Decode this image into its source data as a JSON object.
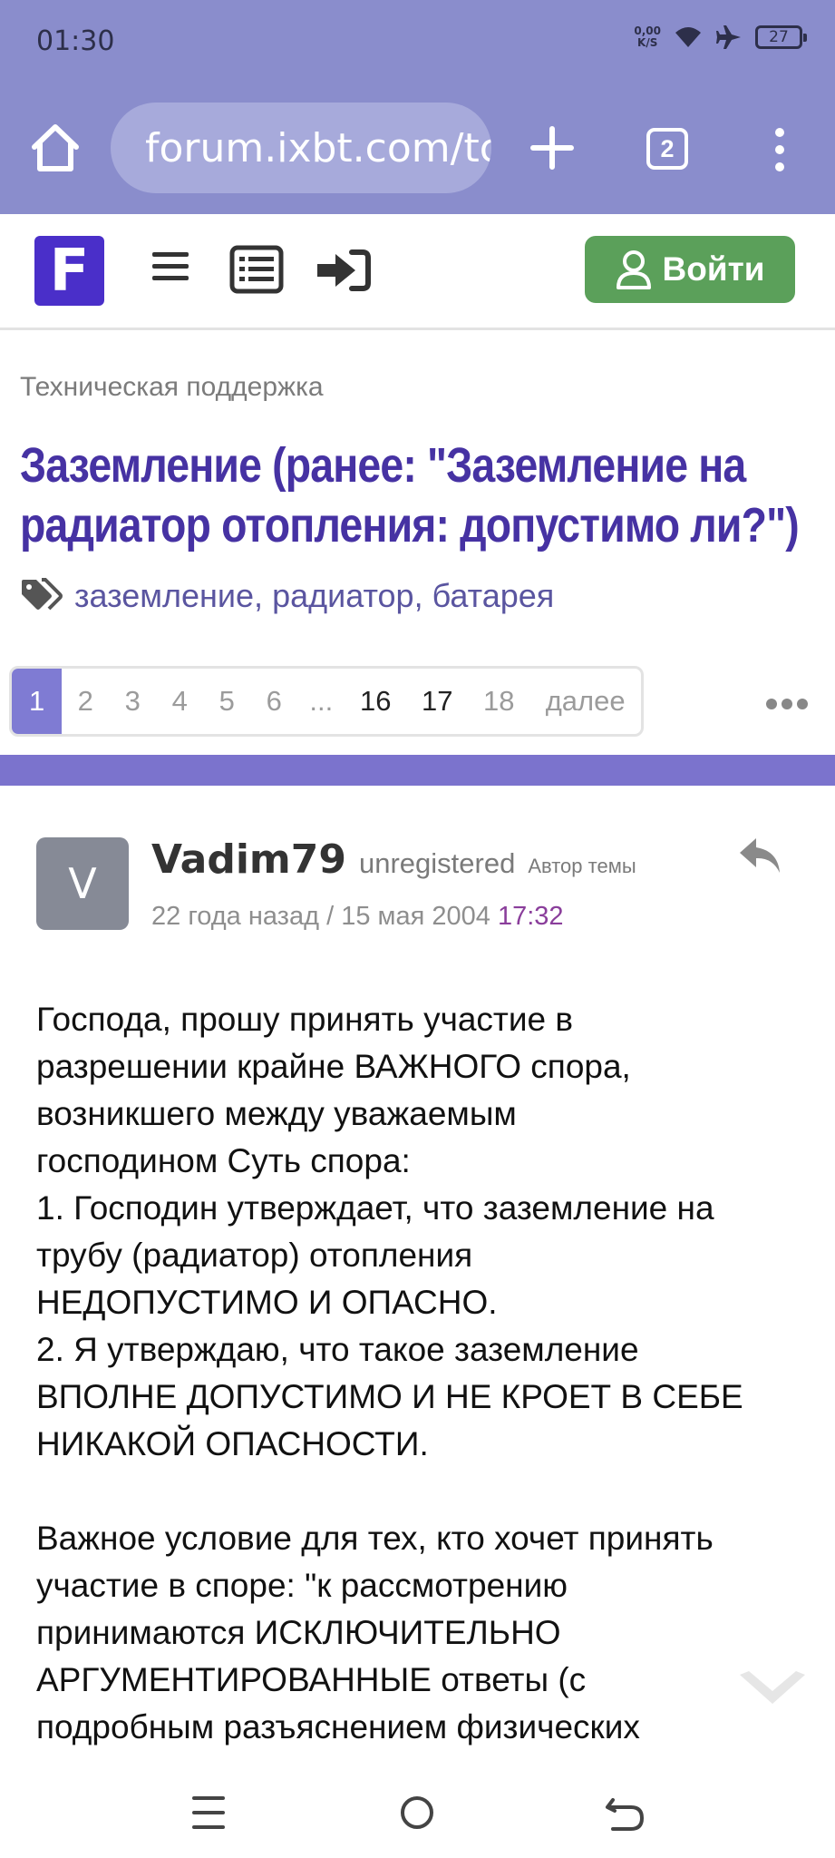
{
  "status_bar": {
    "time": "01:30",
    "net_speed_value": "0,00",
    "net_speed_unit": "K/S",
    "battery": "27"
  },
  "browser": {
    "url": "forum.ixbt.com/tc",
    "tab_count": "2"
  },
  "site_header": {
    "logo_letter": "F",
    "login_label": "Войти"
  },
  "topic": {
    "breadcrumb": "Техническая поддержка",
    "title_line1": "Заземление (ранее: \"Заземление на",
    "title_line2": "радиатор отопления: допустимо ли?\")",
    "tags": [
      "заземление",
      "радиатор",
      "батарея"
    ]
  },
  "pagination": {
    "pages": [
      "1",
      "2",
      "3",
      "4",
      "5",
      "6",
      "...",
      "16",
      "17",
      "18"
    ],
    "next_label": "далее",
    "current": "1"
  },
  "post": {
    "avatar_letter": "V",
    "author": "Vadim79",
    "status": "unregistered",
    "role": "Автор темы",
    "date_relative": "22 года назад",
    "date_sep": "/",
    "date_absolute": "15 мая 2004",
    "time": "17:32",
    "body_lines": [
      "Господа, прошу принять участие в",
      "разрешении крайне ВАЖНОГО спора,",
      "возникшего между уважаемым",
      "господином Суть спора:",
      "1. Господин утверждает, что заземление на",
      "трубу (радиатор) отопления",
      "НЕДОПУСТИМО И ОПАСНО.",
      "2. Я утверждаю, что такое заземление",
      "ВПОЛНЕ ДОПУСТИМО И НЕ КРОЕТ В СЕБЕ",
      "НИКАКОЙ ОПАСНОСТИ.",
      "",
      "Важное условие для тех, кто хочет принять",
      "участие в споре: \"к рассмотрению",
      "принимаются ИСКЛЮЧИТЕЛЬНО",
      "АРГУМЕНТИРОВАННЫЕ ответы (с",
      "подробным разъяснением физических"
    ]
  },
  "colors": {
    "chrome": "#8a8dcc",
    "logo": "#4a2fc9",
    "login": "#5ba05a",
    "title": "#4632a3",
    "accent_bar": "#7b73cd",
    "active_page": "#7f7bd3"
  }
}
